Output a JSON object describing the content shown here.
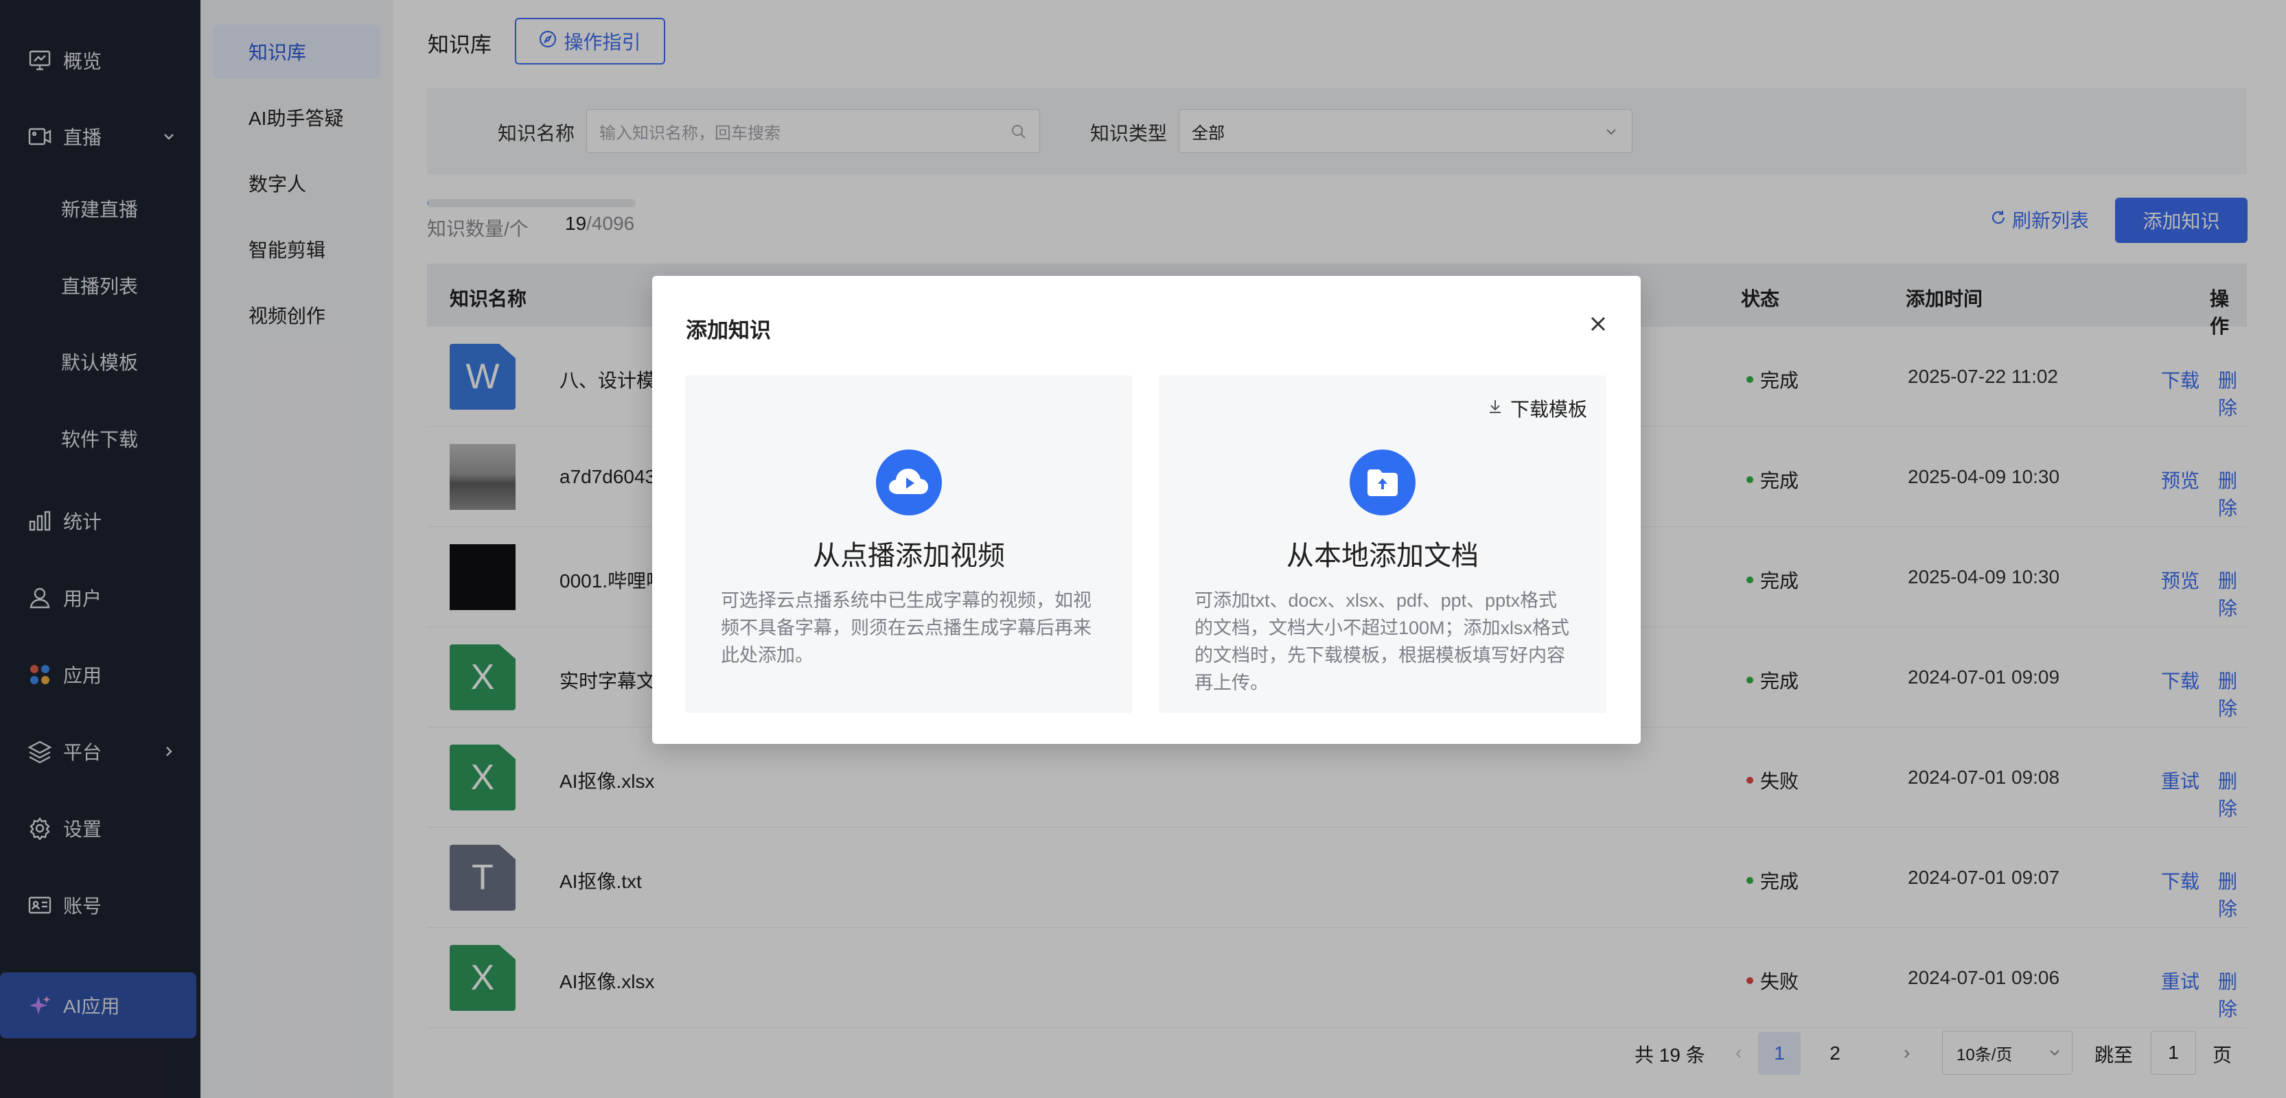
{
  "sidebar": {
    "items": [
      {
        "label": "概览",
        "icon": "monitor-chart-icon"
      },
      {
        "label": "直播",
        "icon": "live-video-icon",
        "arrow": "chevron-down-icon"
      },
      {
        "label": "新建直播"
      },
      {
        "label": "直播列表"
      },
      {
        "label": "默认模板"
      },
      {
        "label": "软件下载"
      },
      {
        "label": "统计",
        "icon": "bar-chart-icon"
      },
      {
        "label": "用户",
        "icon": "user-icon"
      },
      {
        "label": "应用",
        "icon": "apps-icon"
      },
      {
        "label": "平台",
        "icon": "layers-icon",
        "arrow": "chevron-right-icon"
      },
      {
        "label": "设置",
        "icon": "gear-icon"
      },
      {
        "label": "账号",
        "icon": "id-card-icon"
      },
      {
        "label": "AI应用",
        "icon": "sparkle-icon"
      }
    ]
  },
  "subnav": {
    "items": [
      "知识库",
      "AI助手答疑",
      "数字人",
      "智能剪辑",
      "视频创作"
    ]
  },
  "header": {
    "title": "知识库",
    "guide_label": "操作指引"
  },
  "filters": {
    "name_label": "知识名称",
    "name_placeholder": "输入知识名称，回车搜索",
    "type_label": "知识类型",
    "type_value": "全部"
  },
  "count": {
    "label": "知识数量/个",
    "used": "19",
    "total": "/4096",
    "fraction": 0.0046
  },
  "toolbar": {
    "refresh_label": "刷新列表",
    "add_label": "添加知识"
  },
  "table": {
    "headers": {
      "name": "知识名称",
      "status": "状态",
      "time": "添加时间",
      "action": "操作"
    },
    "rows": [
      {
        "thumb": "word",
        "letter": "W",
        "name": "八、设计模式知",
        "status": "完成",
        "ok": true,
        "time": "2025-07-22 11:02",
        "act1": "下载",
        "act2": "删除"
      },
      {
        "thumb": "photo",
        "letter": "",
        "name": "a7d7d604373e",
        "status": "完成",
        "ok": true,
        "time": "2025-04-09 10:30",
        "act1": "预览",
        "act2": "删除"
      },
      {
        "thumb": "dark",
        "letter": "",
        "name": "0001.哔哩哔哩",
        "status": "完成",
        "ok": true,
        "time": "2025-04-09 10:30",
        "act1": "预览",
        "act2": "删除"
      },
      {
        "thumb": "excel",
        "letter": "X",
        "name": "实时字幕文本翻",
        "status": "完成",
        "ok": true,
        "time": "2024-07-01 09:09",
        "act1": "下载",
        "act2": "删除"
      },
      {
        "thumb": "excel",
        "letter": "X",
        "name": "AI抠像.xlsx",
        "status": "失败",
        "ok": false,
        "time": "2024-07-01 09:08",
        "act1": "重试",
        "act2": "删除"
      },
      {
        "thumb": "text",
        "letter": "T",
        "name": "AI抠像.txt",
        "status": "完成",
        "ok": true,
        "time": "2024-07-01 09:07",
        "act1": "下载",
        "act2": "删除"
      },
      {
        "thumb": "excel",
        "letter": "X",
        "name": "AI抠像.xlsx",
        "status": "失败",
        "ok": false,
        "time": "2024-07-01 09:06",
        "act1": "重试",
        "act2": "删除"
      }
    ]
  },
  "pagination": {
    "total": "共 19 条",
    "prev": "‹",
    "pages": [
      "1",
      "2"
    ],
    "current": "1",
    "next": "›",
    "page_size": "10条/页",
    "jump_label": "跳至",
    "jump_value": "1",
    "page_unit": "页"
  },
  "modal": {
    "title": "添加知识",
    "close_icon": "close-icon",
    "video_card": {
      "title": "从点播添加视频",
      "desc": "可选择云点播系统中已生成字幕的视频，如视频不具备字幕，则须在云点播生成字幕后再来此处添加。"
    },
    "doc_card": {
      "title": "从本地添加文档",
      "desc": "可添加txt、docx、xlsx、pdf、ppt、pptx格式的文档，文档大小不超过100M；添加xlsx格式的文档时，先下载模板，根据模板填写好内容再上传。",
      "template_label": "下载模板"
    }
  },
  "colors": {
    "accent": "#3d6ef0",
    "sidebar_bg": "#1e2330",
    "sidebar_active": "#3152a8",
    "status_ok": "#2fb344",
    "status_fail": "#e54545",
    "word": "#3b7be0",
    "excel": "#2e9a5d",
    "text": "#6a7284"
  }
}
